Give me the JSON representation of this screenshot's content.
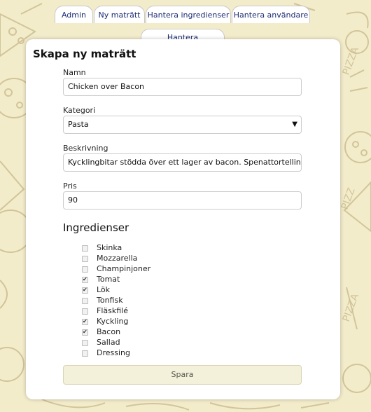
{
  "nav": {
    "tabs": [
      {
        "label": "Admin"
      },
      {
        "label": "Ny maträtt"
      },
      {
        "label": "Hantera ingredienser"
      },
      {
        "label": "Hantera användare"
      },
      {
        "label": "Hantera beställningar"
      }
    ]
  },
  "form": {
    "title": "Skapa ny maträtt",
    "name_label": "Namn",
    "name_value": "Chicken over Bacon",
    "category_label": "Kategori",
    "category_value": "Pasta",
    "description_label": "Beskrivning",
    "description_value": "Kycklingbitar stödda över ett lager av bacon. Spenattortellini vid sidan.",
    "price_label": "Pris",
    "price_value": "90",
    "ingredients_title": "Ingredienser",
    "ingredients": [
      {
        "name": "Skinka",
        "checked": false
      },
      {
        "name": "Mozzarella",
        "checked": false
      },
      {
        "name": "Champinjoner",
        "checked": false
      },
      {
        "name": "Tomat",
        "checked": true
      },
      {
        "name": "Lök",
        "checked": true
      },
      {
        "name": "Tonfisk",
        "checked": false
      },
      {
        "name": "Fläskfilé",
        "checked": false
      },
      {
        "name": "Kyckling",
        "checked": true
      },
      {
        "name": "Bacon",
        "checked": true
      },
      {
        "name": "Sallad",
        "checked": false
      },
      {
        "name": "Dressing",
        "checked": false
      }
    ],
    "save_label": "Spara"
  },
  "icons": {
    "dropdown": "chevron-down-icon",
    "checkbox_checked": "check-icon"
  },
  "colors": {
    "background": "#f3eccb",
    "tab_text": "#1d2d74",
    "save_button": "#f3f1d9"
  }
}
